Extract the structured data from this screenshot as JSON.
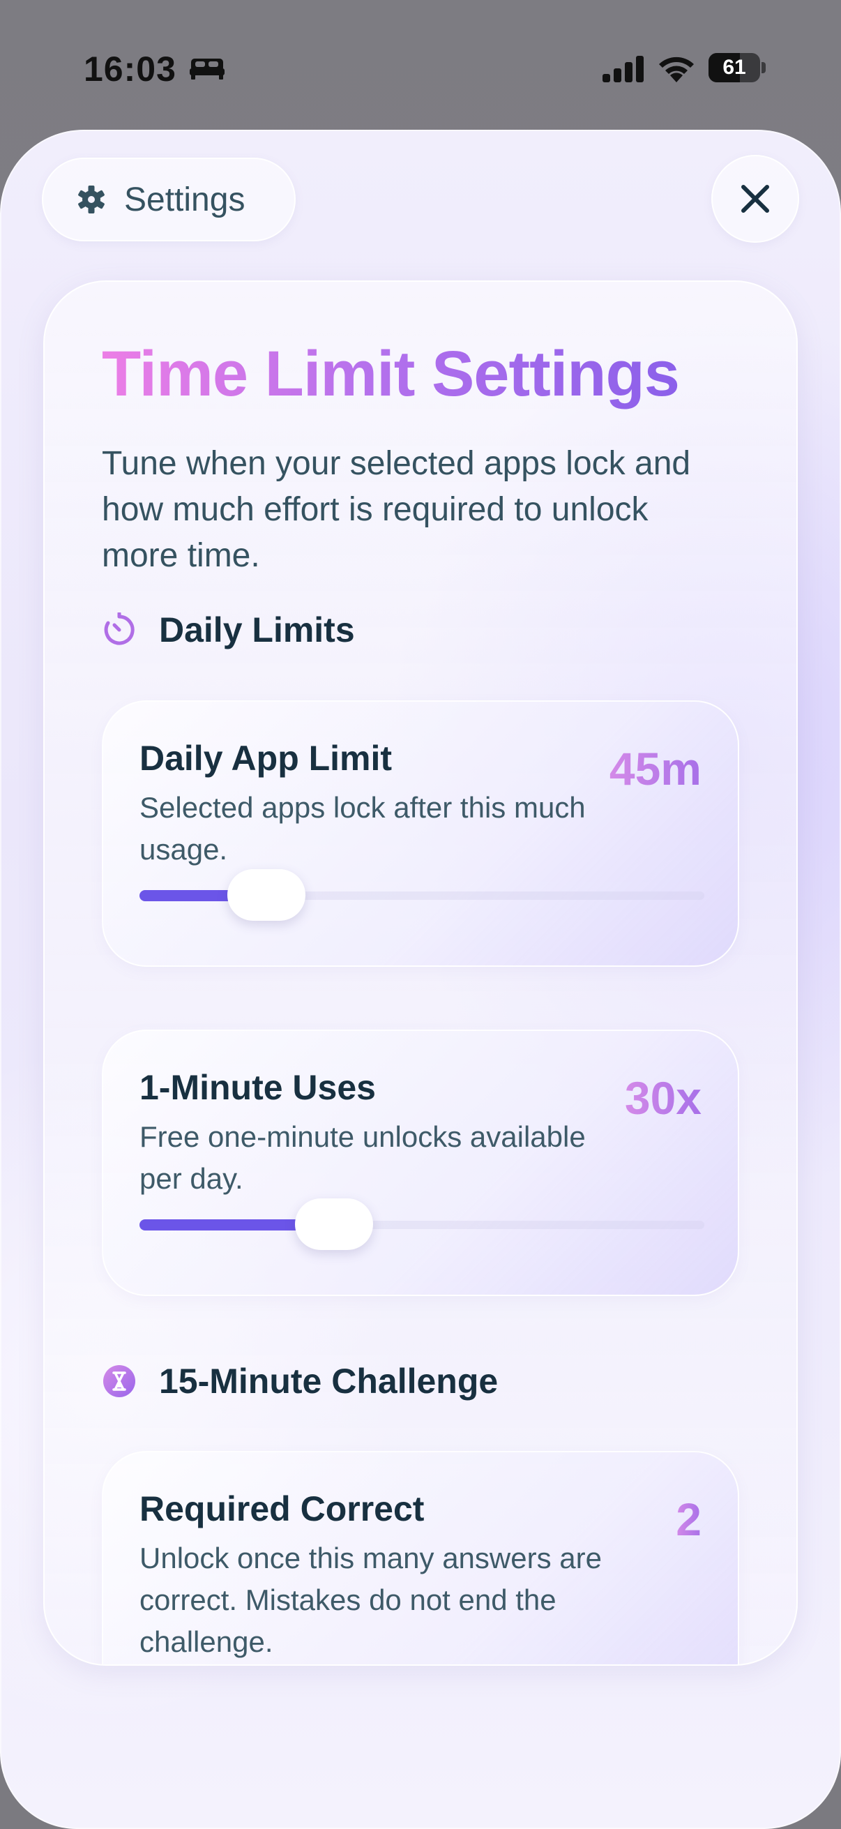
{
  "status_bar": {
    "time": "16:03",
    "focus_icon": "bed-icon",
    "battery_level": "61",
    "battery_fraction": 0.61
  },
  "header": {
    "title": "Settings",
    "icon": "gear-icon",
    "close_icon": "close-icon"
  },
  "main": {
    "title": "Time Limit Settings",
    "subtitle": "Tune when your selected apps lock and how much effort is required to unlock more time.",
    "colors": {
      "title_gradient_start": "#ec7ee6",
      "title_gradient_end": "#8b60ea",
      "accent": "#6b55e8",
      "text_primary": "#183040",
      "text_secondary": "#3e5a68"
    },
    "sections": [
      {
        "title": "Daily Limits",
        "icon": "timer-icon",
        "settings": [
          {
            "title": "Daily App Limit",
            "description": "Selected apps lock after this much usage.",
            "value": "45m",
            "slider_fraction": 0.165
          },
          {
            "title": "1-Minute Uses",
            "description": "Free one-minute unlocks available per day.",
            "value": "30x",
            "slider_fraction": 0.285
          }
        ]
      },
      {
        "title": "15-Minute Challenge",
        "icon": "hourglass-icon",
        "settings": [
          {
            "title": "Required Correct",
            "description": "Unlock once this many answers are correct. Mistakes do not end the challenge.",
            "value": "2"
          }
        ]
      }
    ]
  }
}
